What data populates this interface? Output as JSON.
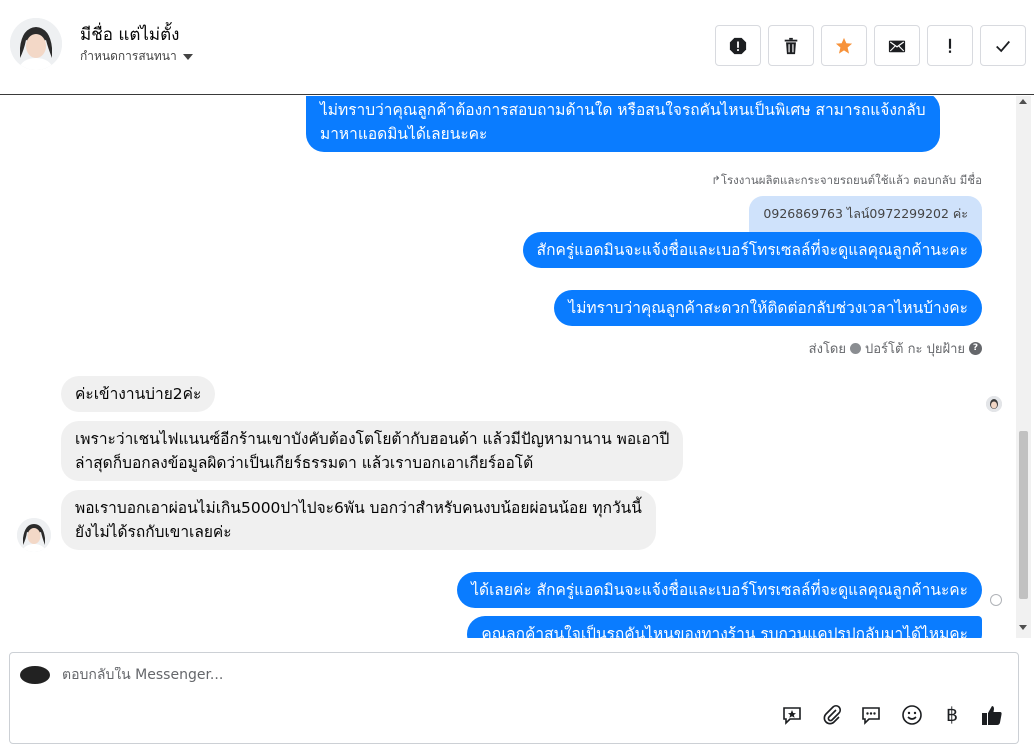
{
  "header": {
    "name": "มีชื่อ แต่ไม่ตั้ง",
    "subtitle": "กำหนดการสนทนา",
    "actions": [
      {
        "icon": "alert-octagon-icon",
        "label": "spam"
      },
      {
        "icon": "trash-icon",
        "label": "delete"
      },
      {
        "icon": "star-icon",
        "label": "star"
      },
      {
        "icon": "envelope-icon",
        "label": "mark unread"
      },
      {
        "icon": "exclamation-icon",
        "label": "follow up"
      },
      {
        "icon": "check-icon",
        "label": "done"
      }
    ],
    "colors": {
      "star": "#f7923a"
    }
  },
  "messages": {
    "m1_line1": "ไม่ทราบว่าคุณลูกค้าต้องการสอบถามด้านใด หรือสนใจรถคันไหนเป็นพิเศษ สามารถแจ้งกลับ",
    "m1_line2": "มาหาแอดมินได้เลยนะคะ",
    "reply_meta": "↱โรงงานผลิตและกระจายรถยนต์ใช้แล้ว ตอบกลับ มีชื่อ",
    "reply_quote": "0926869763 ไลน์0972299202 ค่ะ",
    "m2": "สักครู่แอดมินจะแจ้งชื่อและเบอร์โทรเซลล์ที่จะดูแลคุณลูกค้านะคะ",
    "m3": "ไม่ทราบว่าคุณลูกค้าสะดวกให้ติดต่อกลับช่วงเวลาไหนบ้างคะ",
    "sent_by_prefix": "ส่งโดย",
    "sent_by_name": "ปอร์โต้ กะ ปุยฝ้าย",
    "in1": "ค่ะเข้างานบ่าย2ค่ะ",
    "in2_line1": "เพราะว่าเชนไฟแนนซ์อีกร้านเขาบังคับต้องโตโยต้ากับฮอนด้า แล้วมีปัญหามานาน พอเอาปี",
    "in2_line2": "ล่าสุดก็บอกลงข้อมูลผิดว่าเป็นเกียร์ธรรมดา แล้วเราบอกเอาเกียร์ออโต้",
    "in3_line1": "พอเราบอกเอาผ่อนไม่เกิน5000ปาไปจะ6พัน บอกว่าสำหรับคนงบน้อยผ่อนน้อย   ทุกวันนี้",
    "in3_line2": "ยังไม่ได้รถกับเขาเลยค่ะ",
    "m4": "ได้เลยค่ะ สักครู่แอดมินจะแจ้งชื่อและเบอร์โทรเซลล์ที่จะดูแลคุณลูกค้านะคะ",
    "m5_partial": "คุณลูกค้าสนใจเป็นรถคันไหนของทางร้าน รบกวนแคปรูปกลับมาได้ไหมคะ"
  },
  "composer": {
    "placeholder": "ตอบกลับใน Messenger...",
    "tools": [
      "saved-reply-icon",
      "attachment-icon",
      "chat-bubbles-icon",
      "emoji-icon",
      "baht-icon",
      "thumbs-up-icon"
    ],
    "baht_symbol": "฿"
  },
  "colors": {
    "outgoing_bubble": "#0a7cff",
    "incoming_bubble": "#f0f0f0",
    "reply_quote": "#cfe2fb"
  }
}
